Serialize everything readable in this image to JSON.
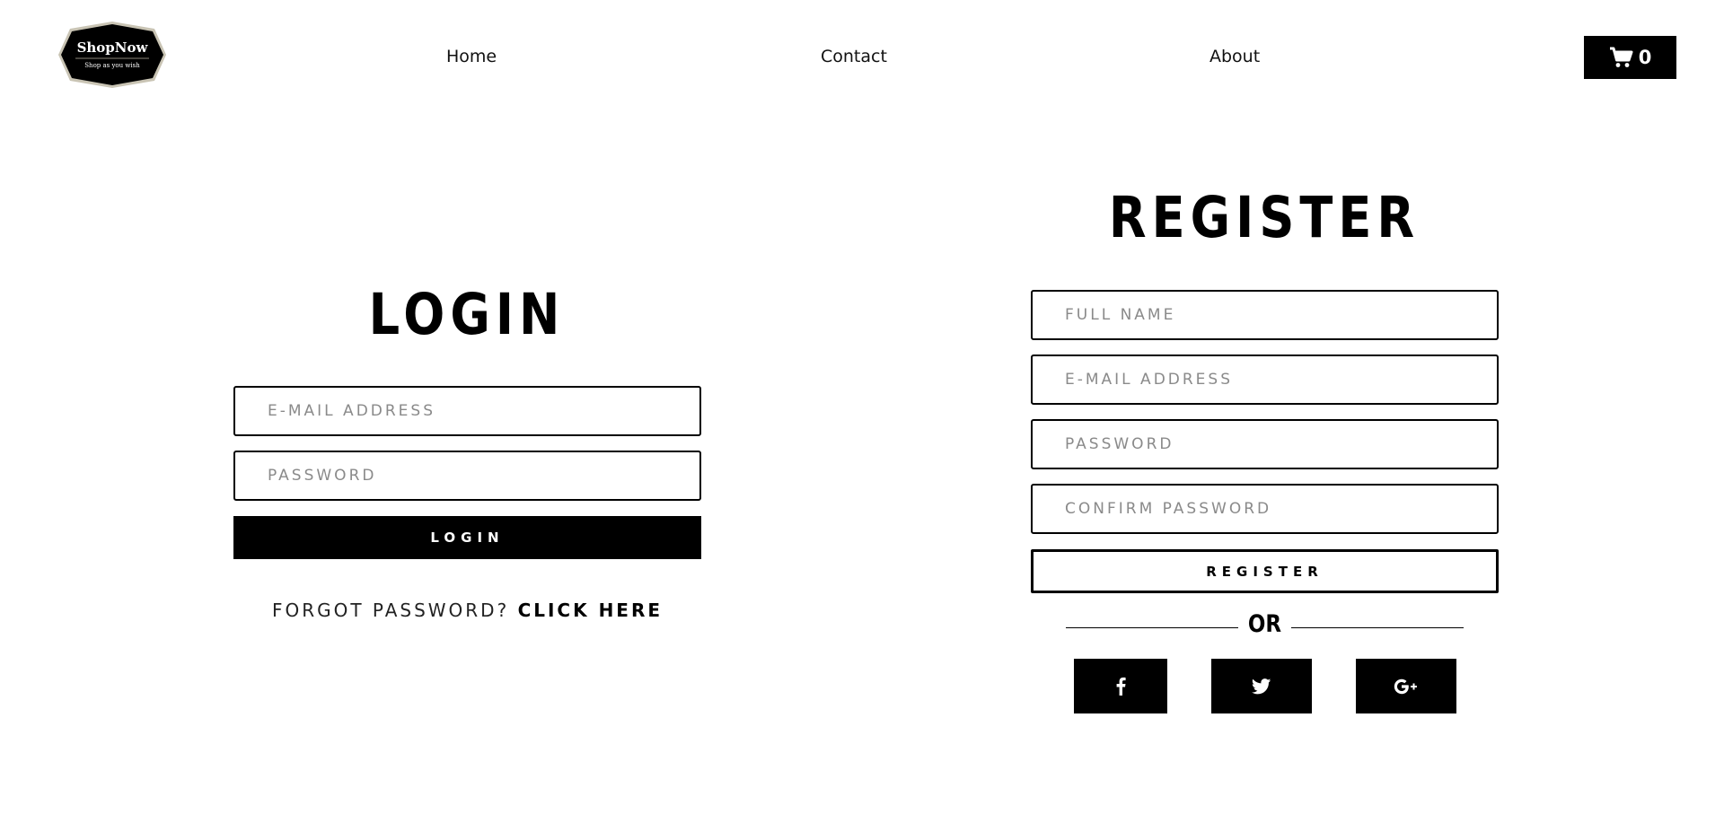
{
  "header": {
    "logo": {
      "name": "ShopNow",
      "tagline": "Shop as you wish"
    },
    "nav": [
      {
        "label": "Home"
      },
      {
        "label": "Contact"
      },
      {
        "label": "About"
      }
    ],
    "cart": {
      "icon": "cart-icon",
      "count": "0"
    }
  },
  "login": {
    "title": "LOGIN",
    "email_placeholder": "E-MAIL ADDRESS",
    "password_placeholder": "PASSWORD",
    "button_label": "LOGIN",
    "forgot_text": "FORGOT PASSWORD? ",
    "forgot_link": "CLICK HERE"
  },
  "register": {
    "title": "REGISTER",
    "fullname_placeholder": "FULL NAME",
    "email_placeholder": "E-MAIL ADDRESS",
    "password_placeholder": "PASSWORD",
    "confirm_placeholder": "CONFIRM PASSWORD",
    "button_label": "REGISTER",
    "or_text": "OR",
    "social": [
      {
        "icon": "facebook-icon"
      },
      {
        "icon": "twitter-icon"
      },
      {
        "icon": "google-plus-icon"
      }
    ]
  },
  "colors": {
    "primary": "#000000",
    "background": "#ffffff",
    "placeholder": "#8a8a8a"
  }
}
